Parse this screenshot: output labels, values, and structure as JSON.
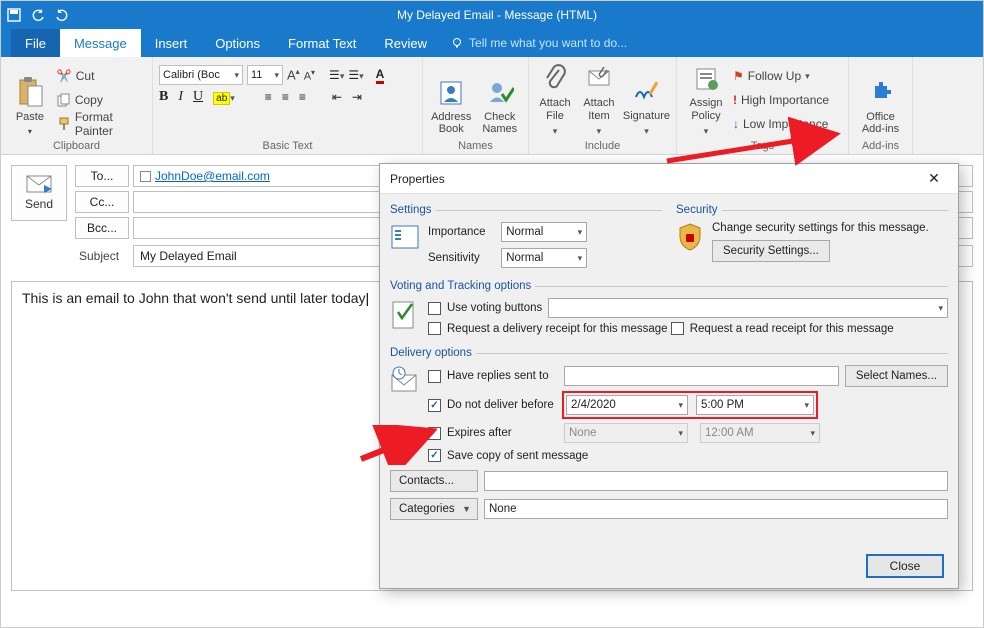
{
  "titlebar": {
    "title": "My Delayed Email  -  Message (HTML)"
  },
  "tabs": {
    "file": "File",
    "message": "Message",
    "insert": "Insert",
    "options": "Options",
    "format": "Format Text",
    "review": "Review",
    "tellme": "Tell me what you want to do..."
  },
  "ribbon": {
    "clipboard": {
      "paste": "Paste",
      "cut": "Cut",
      "copy": "Copy",
      "painter": "Format Painter",
      "label": "Clipboard"
    },
    "basic_text": {
      "font": "Calibri (Boc",
      "size": "11",
      "label": "Basic Text"
    },
    "names": {
      "address_book": "Address\nBook",
      "check_names": "Check\nNames",
      "label": "Names"
    },
    "include": {
      "attach_file": "Attach\nFile",
      "attach_item": "Attach\nItem",
      "signature": "Signature",
      "label": "Include"
    },
    "tags": {
      "assign_policy": "Assign\nPolicy",
      "follow_up": "Follow Up",
      "high": "High Importance",
      "low": "Low Importance",
      "label": "Tags"
    },
    "addins": {
      "office": "Office\nAdd-ins",
      "label": "Add-ins"
    }
  },
  "compose": {
    "send": "Send",
    "to_btn": "To...",
    "cc_btn": "Cc...",
    "bcc_btn": "Bcc...",
    "to_value": "JohnDoe@email.com",
    "subject_label": "Subject",
    "subject_value": "My Delayed Email",
    "body": "This is an email to John that won't send until later today"
  },
  "dialog": {
    "title": "Properties",
    "settings_legend": "Settings",
    "importance_label": "Importance",
    "importance_value": "Normal",
    "sensitivity_label": "Sensitivity",
    "sensitivity_value": "Normal",
    "security_legend": "Security",
    "security_text": "Change security settings for this message.",
    "security_btn": "Security Settings...",
    "voting_legend": "Voting and Tracking options",
    "voting_chk": "Use voting buttons",
    "delivery_receipt": "Request a delivery receipt for this message",
    "read_receipt": "Request a read receipt for this message",
    "delivery_legend": "Delivery options",
    "replies_chk": "Have replies sent to",
    "select_names": "Select Names...",
    "no_deliver_chk": "Do not deliver before",
    "no_deliver_date": "2/4/2020",
    "no_deliver_time": "5:00 PM",
    "expires_chk": "Expires after",
    "expires_date": "None",
    "expires_time": "12:00 AM",
    "save_copy": "Save copy of sent message",
    "contacts_btn": "Contacts...",
    "categories_btn": "Categories",
    "categories_value": "None",
    "close": "Close"
  }
}
